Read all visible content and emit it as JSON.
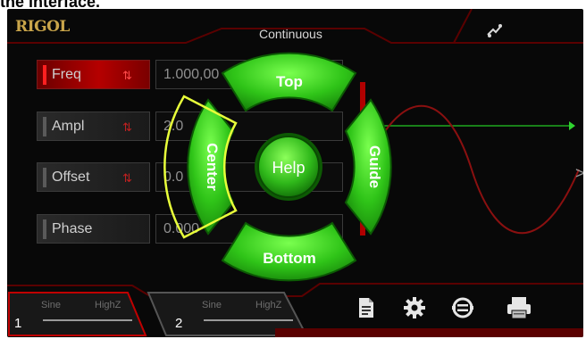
{
  "caption": "the interface.",
  "header": {
    "logo": "RIGOL",
    "mode": "Continuous"
  },
  "params": [
    {
      "label": "Freq",
      "value": "1.000,00",
      "active": true
    },
    {
      "label": "Ampl",
      "value": "2.0"
    },
    {
      "label": "Offset",
      "value": "0.0          Vdc"
    },
    {
      "label": "Phase",
      "value": "0.000 °"
    }
  ],
  "channels": [
    {
      "number": "1",
      "type": "Sine",
      "impedance": "HighZ"
    },
    {
      "number": "2",
      "type": "Sine",
      "impedance": "HighZ"
    }
  ],
  "help_menu": {
    "top": "Top",
    "bottom": "Bottom",
    "center": "Center",
    "guide": "Guide",
    "help": "Help"
  },
  "colors": {
    "accent": "#2fc418",
    "highlight": "#e8ff3a",
    "param_active": "#b50000",
    "waveform": "#8a1010",
    "trigger_line": "#1fa81f"
  },
  "icons": [
    "wave-link-icon",
    "document-icon",
    "gear-icon",
    "channel-swap-icon",
    "printer-icon",
    "swap-icon"
  ]
}
